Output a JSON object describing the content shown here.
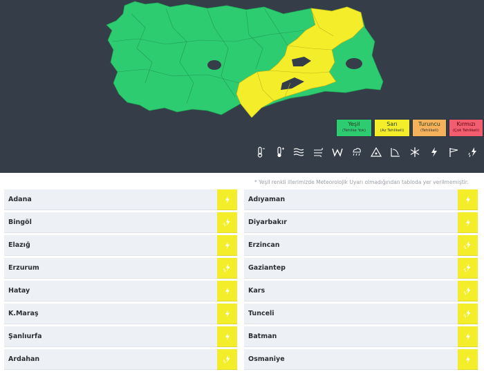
{
  "legend": [
    {
      "name": "Yeşil",
      "sub": "(Tehlike Yok)",
      "color": "#2ecc71"
    },
    {
      "name": "Sarı",
      "sub": "(Az Tehlikeli)",
      "color": "#f4ee2a"
    },
    {
      "name": "Turuncu",
      "sub": "(Tehlikeli)",
      "color": "#f6b25b"
    },
    {
      "name": "Kırmızı",
      "sub": "(Çok Tehlikeli)",
      "color": "#f25d6f"
    }
  ],
  "icons": [
    "low-temperature-icon",
    "high-temperature-icon",
    "fog-icon",
    "dust-icon",
    "wind-icon",
    "rain-icon",
    "avalanche-icon",
    "icing-icon",
    "snow-icon",
    "thunderstorm-icon",
    "storm-icon",
    "rain-thunder-icon"
  ],
  "note": "* Yeşil renkli illerimizde Meteorolojik Uyarı olmadığından tabloda yer verilmemiştir.",
  "provinces": [
    {
      "left": "Adana",
      "left_icon": "thunderstorm-icon",
      "right": "Adıyaman",
      "right_icon": "thunderstorm-icon"
    },
    {
      "left": "Bingöl",
      "left_icon": "rain-thunder-icon",
      "right": "Diyarbakır",
      "right_icon": "thunderstorm-icon"
    },
    {
      "left": "Elazığ",
      "left_icon": "thunderstorm-icon",
      "right": "Erzincan",
      "right_icon": "rain-thunder-icon"
    },
    {
      "left": "Erzurum",
      "left_icon": "rain-thunder-icon",
      "right": "Gaziantep",
      "right_icon": "rain-thunder-icon"
    },
    {
      "left": "Hatay",
      "left_icon": "thunderstorm-icon",
      "right": "Kars",
      "right_icon": "rain-thunder-icon"
    },
    {
      "left": "K.Maraş",
      "left_icon": "thunderstorm-icon",
      "right": "Tunceli",
      "right_icon": "rain-thunder-icon"
    },
    {
      "left": "Şanlıurfa",
      "left_icon": "thunderstorm-icon",
      "right": "Batman",
      "right_icon": "thunderstorm-icon"
    },
    {
      "left": "Ardahan",
      "left_icon": "rain-thunder-icon",
      "right": "Osmaniye",
      "right_icon": "thunderstorm-icon"
    }
  ]
}
